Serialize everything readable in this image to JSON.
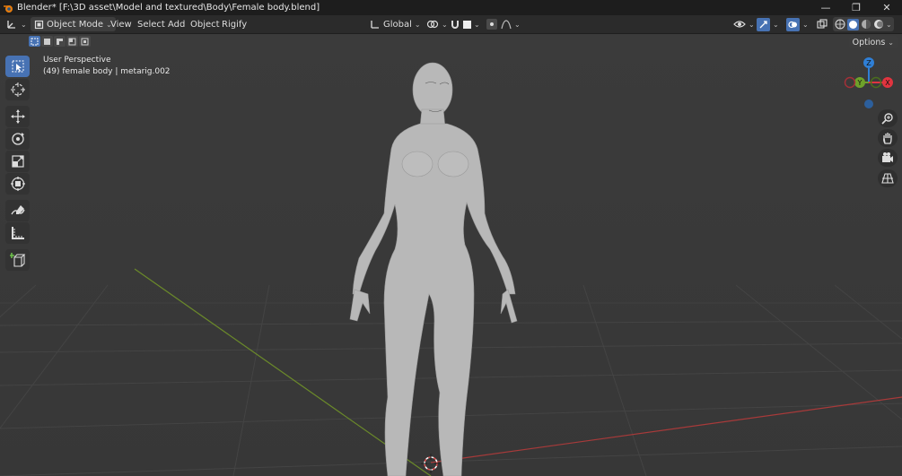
{
  "window": {
    "title": "Blender* [F:\\3D asset\\Model and textured\\Body\\Female body.blend]",
    "controls": [
      "minimize",
      "maximize",
      "close"
    ]
  },
  "header": {
    "editor_type_icon": "axes-icon",
    "mode": "Object Mode",
    "menus": [
      "View",
      "Select",
      "Add",
      "Object",
      "Rigify"
    ],
    "transform_orientation": "Global",
    "pivot_icon": "pivot-icon",
    "snap_icon": "magnet-icon",
    "proportional_icon": "proportional-icon"
  },
  "viewport": {
    "perspective_label": "User Perspective",
    "object_label": "(49) female body | metarig.002",
    "options_label": "Options"
  },
  "gizmo": {
    "z": "Z",
    "y": "Y",
    "x": "X",
    "colors": {
      "x": "#e0343f",
      "y": "#6ea12a",
      "z": "#2f7fd6"
    }
  },
  "tools": [
    "select-box",
    "cursor",
    "move",
    "rotate",
    "scale",
    "transform",
    "annotate",
    "measure",
    "add-cube"
  ],
  "colors": {
    "accent": "#4772b3",
    "viewport_bg": "#3a3a3a",
    "grid_x_axis": "#a83a3a",
    "grid_y_axis": "#6b8a2a"
  }
}
